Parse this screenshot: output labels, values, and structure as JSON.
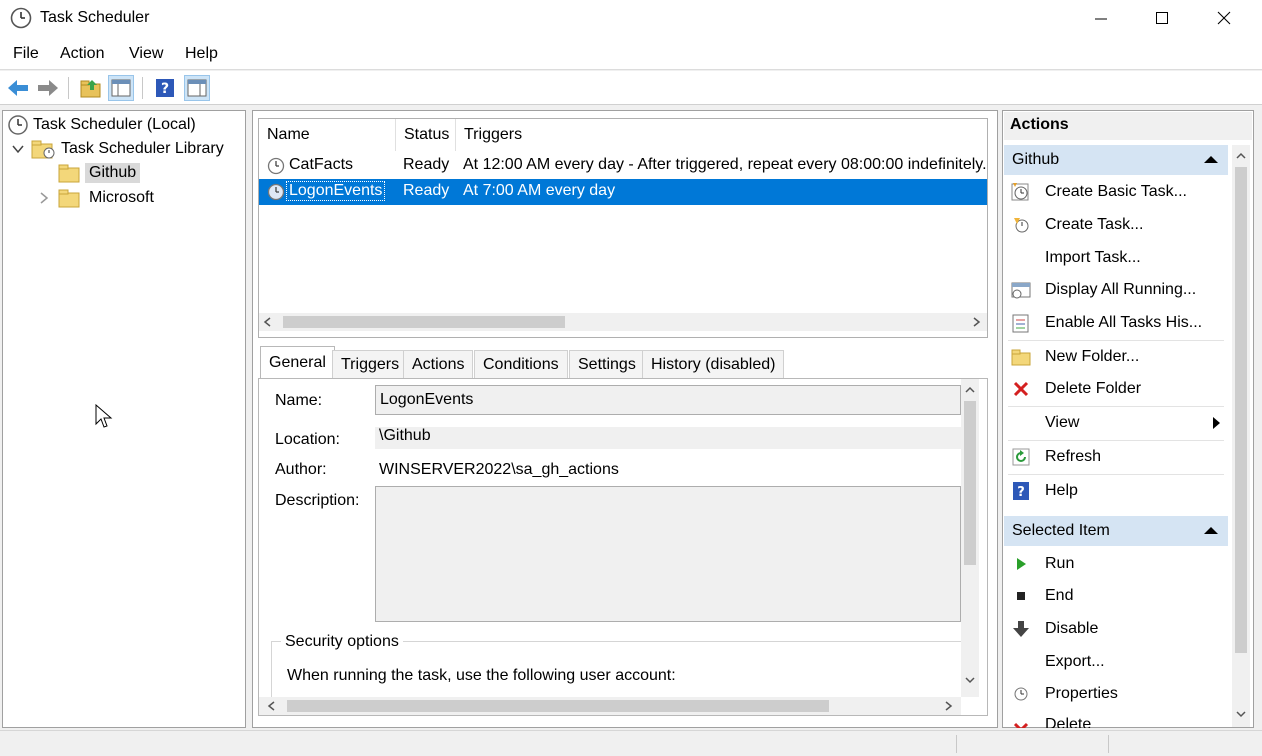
{
  "window": {
    "title": "Task Scheduler"
  },
  "menu": [
    "File",
    "Action",
    "View",
    "Help"
  ],
  "tree": {
    "root": "Task Scheduler (Local)",
    "library": "Task Scheduler Library",
    "github": "Github",
    "microsoft": "Microsoft"
  },
  "task_list": {
    "columns": [
      "Name",
      "Status",
      "Triggers"
    ],
    "rows": [
      {
        "name": "CatFacts",
        "status": "Ready",
        "triggers": "At 12:00 AM every day - After triggered, repeat every 08:00:00 indefinitely."
      },
      {
        "name": "LogonEvents",
        "status": "Ready",
        "triggers": "At 7:00 AM every day"
      }
    ]
  },
  "tabs": [
    "General",
    "Triggers",
    "Actions",
    "Conditions",
    "Settings",
    "History (disabled)"
  ],
  "general": {
    "name_label": "Name:",
    "name_value": "LogonEvents",
    "location_label": "Location:",
    "location_value": "\\Github",
    "author_label": "Author:",
    "author_value": "WINSERVER2022\\sa_gh_actions",
    "description_label": "Description:",
    "security_title": "Security options",
    "security_text": "When running the task, use the following user account:"
  },
  "actions": {
    "header": "Actions",
    "section1": "Github",
    "items1": [
      "Create Basic Task...",
      "Create Task...",
      "Import Task...",
      "Display All Running...",
      "Enable All Tasks His...",
      "New Folder...",
      "Delete Folder",
      "View",
      "Refresh",
      "Help"
    ],
    "section2": "Selected Item",
    "items2": [
      "Run",
      "End",
      "Disable",
      "Export...",
      "Properties",
      "Delete"
    ]
  }
}
